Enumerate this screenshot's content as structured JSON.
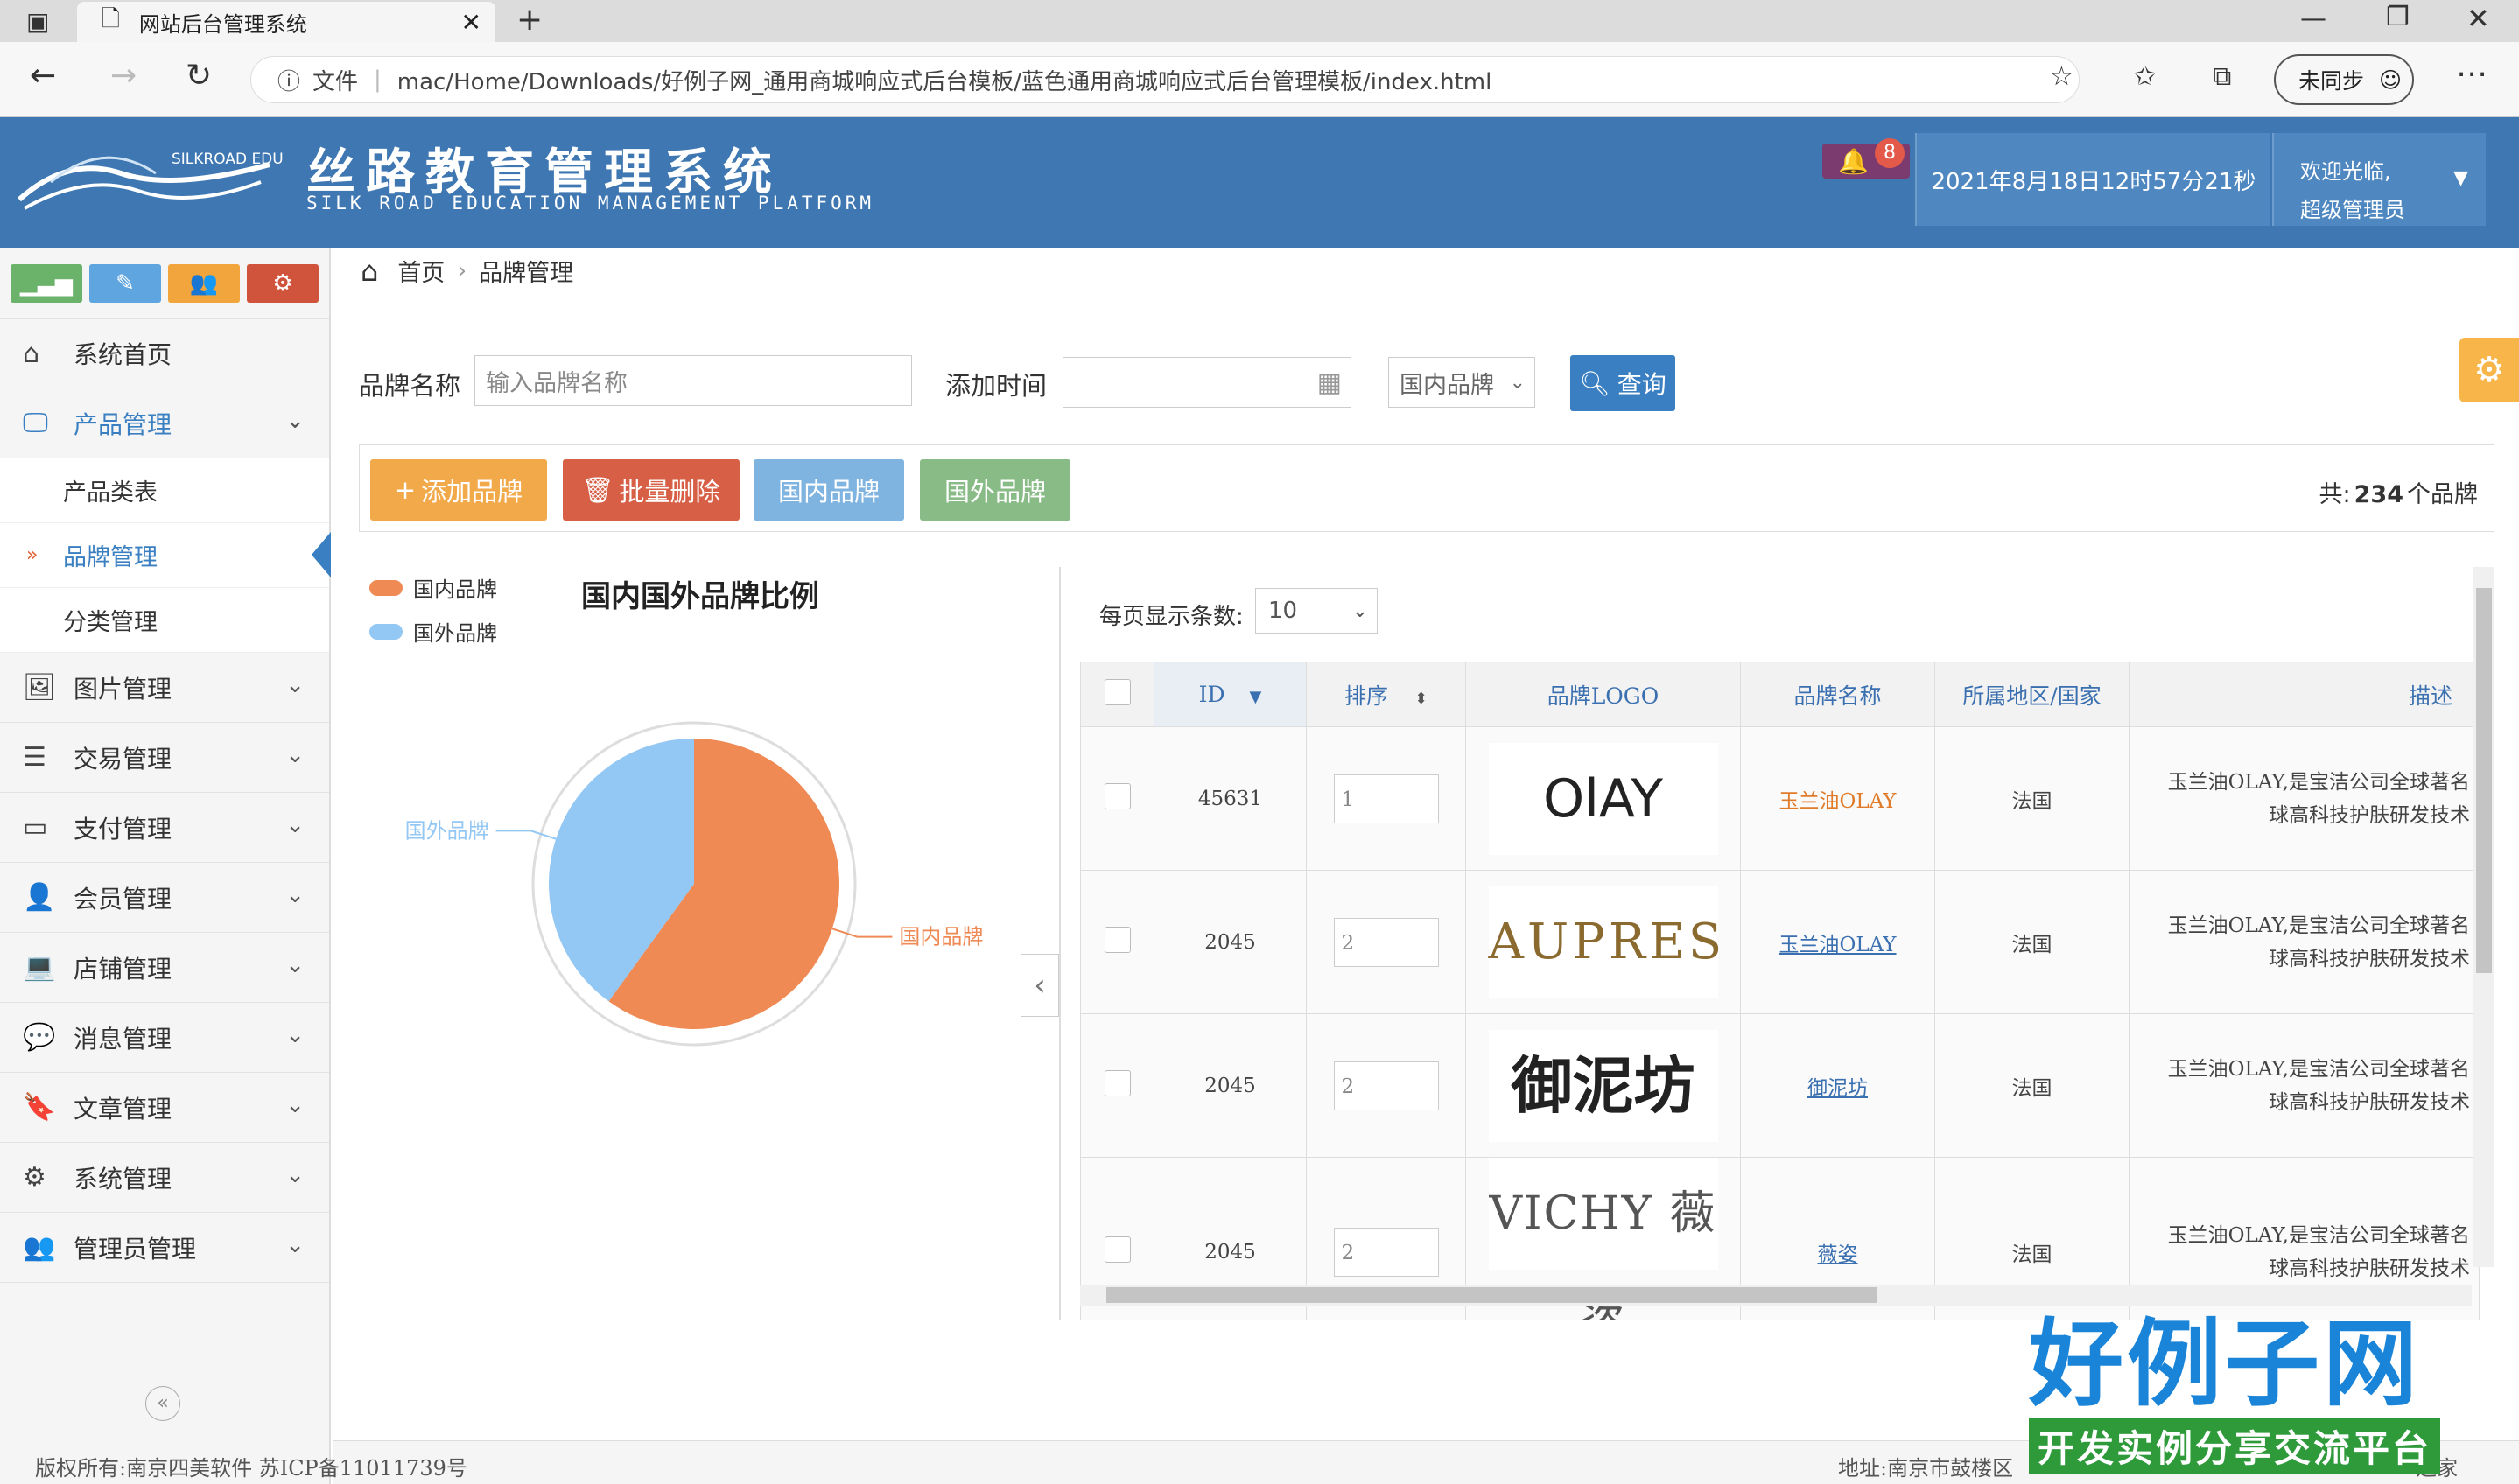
{
  "browser": {
    "tab_title": "网站后台管理系统",
    "url_prefix": "文件",
    "url": "mac/Home/Downloads/好例子网_通用商城响应式后台模板/蓝色通用商城响应式后台管理模板/index.html",
    "sync_label": "未同步"
  },
  "header": {
    "logo_small": "SILKROAD EDU",
    "title": "丝路教育管理系统",
    "subtitle": "SILK ROAD EDUCATION MANAGEMENT PLATFORM",
    "notifications": "8",
    "datetime": "2021年8月18日12时57分21秒",
    "welcome_line1": "欢迎光临,",
    "welcome_line2": "超级管理员"
  },
  "sidebar": {
    "quick_buttons": [
      {
        "icon": "chart-icon",
        "color": "#6bb26a"
      },
      {
        "icon": "pencil-icon",
        "color": "#5fa5e0"
      },
      {
        "icon": "users-icon",
        "color": "#f2a53c"
      },
      {
        "icon": "gears-icon",
        "color": "#d0533c"
      }
    ],
    "items": [
      {
        "label": "系统首页",
        "icon": "home-icon"
      },
      {
        "label": "产品管理",
        "icon": "monitor-icon"
      },
      {
        "label": "图片管理",
        "icon": "image-icon"
      },
      {
        "label": "交易管理",
        "icon": "list-icon"
      },
      {
        "label": "支付管理",
        "icon": "card-icon"
      },
      {
        "label": "会员管理",
        "icon": "user-icon"
      },
      {
        "label": "店铺管理",
        "icon": "laptop-icon"
      },
      {
        "label": "消息管理",
        "icon": "chat-icon"
      },
      {
        "label": "文章管理",
        "icon": "bookmark-icon"
      },
      {
        "label": "系统管理",
        "icon": "gear-icon"
      },
      {
        "label": "管理员管理",
        "icon": "group-icon"
      }
    ],
    "subitems": [
      "产品类表",
      "品牌管理",
      "分类管理"
    ]
  },
  "breadcrumb": {
    "home": "首页",
    "current": "品牌管理"
  },
  "search": {
    "brand_label": "品牌名称",
    "brand_placeholder": "输入品牌名称",
    "date_label": "添加时间",
    "type_value": "国内品牌",
    "query_label": "查询"
  },
  "toolbar": {
    "add": "添加品牌",
    "batch_delete": "批量删除",
    "domestic": "国内品牌",
    "foreign": "国外品牌",
    "total_prefix": "共:",
    "total_count": "234",
    "total_suffix": "个品牌"
  },
  "chart_data": {
    "type": "pie",
    "title": "国内国外品牌比例",
    "categories": [
      "国内品牌",
      "国外品牌"
    ],
    "values": [
      60,
      40
    ],
    "colors": [
      "#ef8a55",
      "#93c7f4"
    ],
    "legend": "top-left"
  },
  "table": {
    "per_page_label": "每页显示条数:",
    "per_page_value": "10",
    "headers": [
      "ID",
      "排序",
      "品牌LOGO",
      "品牌名称",
      "所属地区/国家",
      "描述"
    ],
    "rows": [
      {
        "id": "45631",
        "sort": "1",
        "logo": "OlAY",
        "name": "玉兰油OLAY",
        "region": "法国",
        "desc1": "玉兰油OLAY,是宝洁公司全球著名",
        "desc2": "球高科技护肤研发技术"
      },
      {
        "id": "2045",
        "sort": "2",
        "logo": "AUPRES",
        "name": "玉兰油OLAY",
        "region": "法国",
        "desc1": "玉兰油OLAY,是宝洁公司全球著名",
        "desc2": "球高科技护肤研发技术"
      },
      {
        "id": "2045",
        "sort": "2",
        "logo": "御泥坊",
        "name": "御泥坊",
        "region": "法国",
        "desc1": "玉兰油OLAY,是宝洁公司全球著名",
        "desc2": "球高科技护肤研发技术"
      },
      {
        "id": "2045",
        "sort": "2",
        "logo": "VICHY 薇姿",
        "name": "薇姿",
        "region": "法国",
        "desc1": "玉兰油OLAY,是宝洁公司全球著名",
        "desc2": "球高科技护肤研发技术"
      }
    ]
  },
  "footer": {
    "copyright": "版权所有:南京四美软件 苏ICP备11011739号",
    "address": "地址:南京市鼓楼区",
    "address_tail": "之家"
  },
  "watermark": {
    "title": "好例子网",
    "slogan": "开发实例分享交流平台"
  }
}
